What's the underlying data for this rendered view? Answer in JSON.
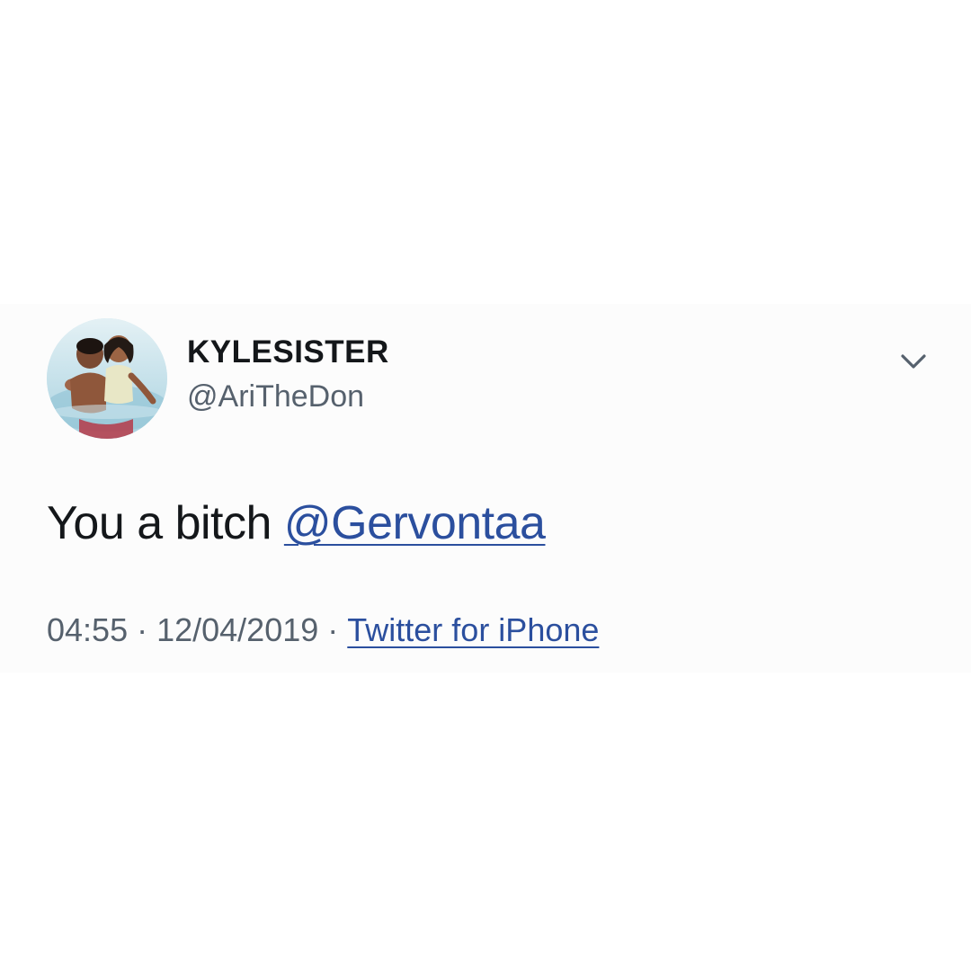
{
  "tweet": {
    "display_name": "KYLESISTER",
    "handle": "@AriTheDon",
    "text_prefix": "You a bitch ",
    "mention": "@Gervontaa",
    "time": "04:55",
    "separator": "·",
    "date": "12/04/2019",
    "source": "Twitter for iPhone",
    "avatar_icon": "profile-photo",
    "menu_icon": "chevron-down-icon"
  },
  "colors": {
    "text": "#14171a",
    "secondary_text": "#56616d",
    "link": "#2b4f9e",
    "card_background": "#fcfcfc"
  }
}
